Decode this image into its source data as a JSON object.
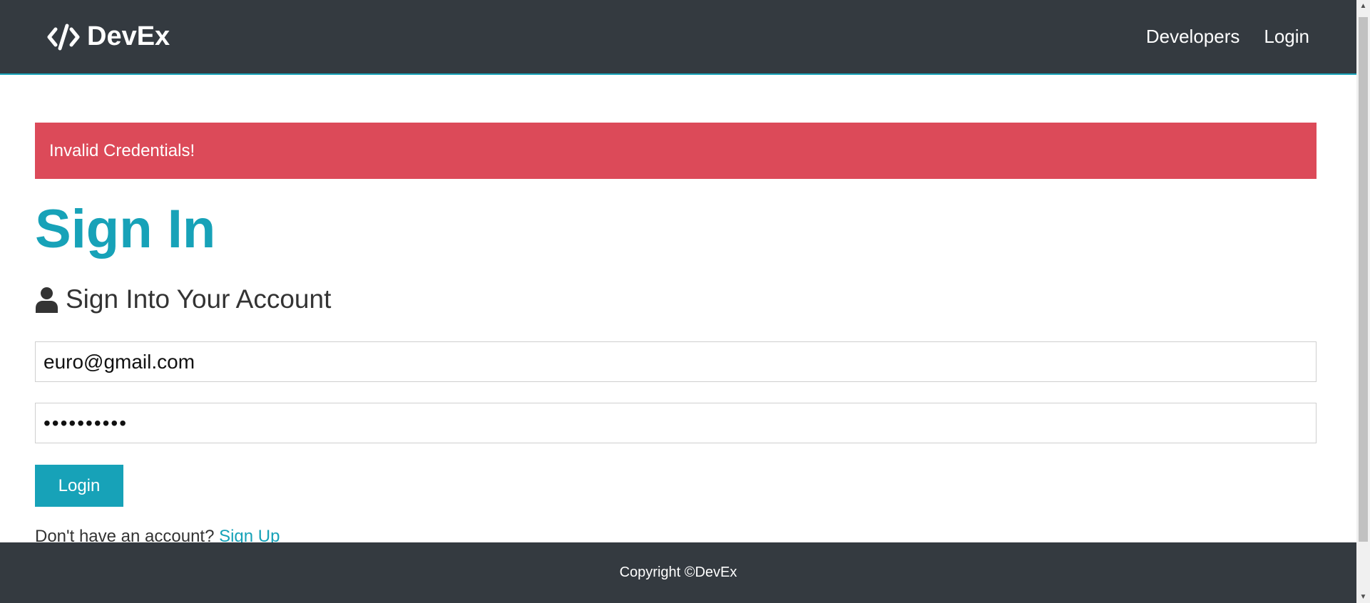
{
  "navbar": {
    "brand_icon": "code-icon",
    "brand": "DevEx",
    "links": [
      "Developers",
      "Login"
    ]
  },
  "alert": {
    "message": "Invalid Credentials!",
    "color": "#dc4a59"
  },
  "page": {
    "title": "Sign In",
    "lead_icon": "user-icon",
    "lead": "Sign Into Your Account"
  },
  "form": {
    "email_value": "euro@gmail.com",
    "password_value": "••••••••••",
    "submit_label": "Login"
  },
  "signup": {
    "prompt": "Don't have an account? ",
    "link": "Sign Up"
  },
  "footer": {
    "text": "Copyright ©DevEx"
  },
  "colors": {
    "accent": "#17a2b8",
    "dark": "#343a40",
    "danger": "#dc4a59"
  }
}
